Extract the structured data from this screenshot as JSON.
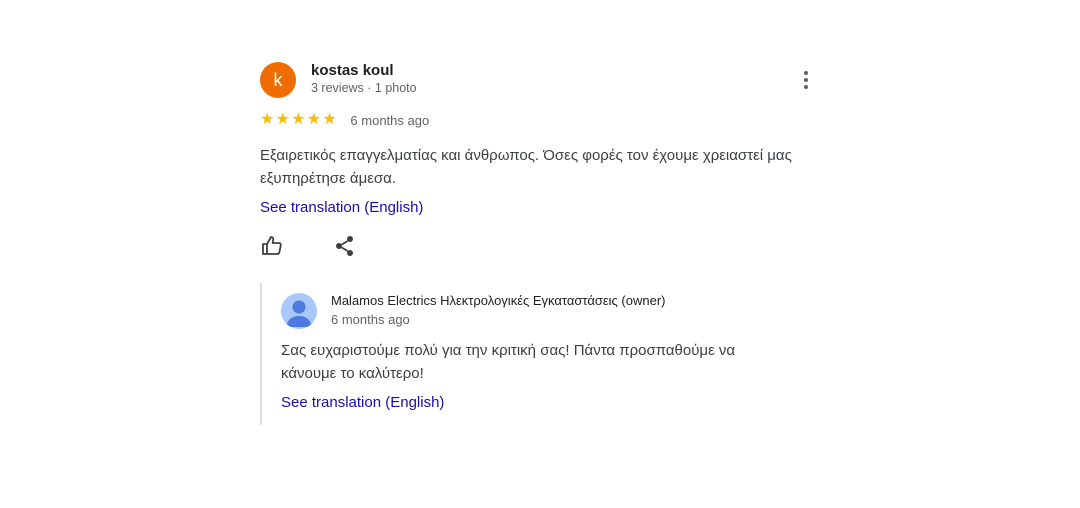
{
  "review": {
    "author": {
      "initial": "k",
      "name": "kostas koul",
      "meta": "3 reviews · 1 photo",
      "avatar_color": "#ef6c00"
    },
    "rating": 5,
    "max_rating": 5,
    "date": "6 months ago",
    "text": "Εξαιρετικός επαγγελματίας και άνθρωπος. Όσες φορές τον έχουμε χρειαστεί μας εξυπηρέτησε άμεσα.",
    "translation_link": "See translation (English)",
    "actions": {
      "like_icon": "thumbs-up-icon",
      "share_icon": "share-icon",
      "more_icon": "more-vert-icon"
    }
  },
  "owner_reply": {
    "name": "Malamos Electrics Ηλεκτρολογικές Εγκαταστάσεις (owner)",
    "date": "6 months ago",
    "text": "Σας ευχαριστούμε πολύ για την κριτική σας! Πάντα προσπαθούμε να κάνουμε το καλύτερο!",
    "translation_link": "See translation (English)",
    "avatar_icon": "person-avatar-icon"
  },
  "colors": {
    "star": "#fbbc04",
    "link": "#1a0dab",
    "secondary_text": "#5f6368",
    "reply_border": "#dadce0"
  }
}
